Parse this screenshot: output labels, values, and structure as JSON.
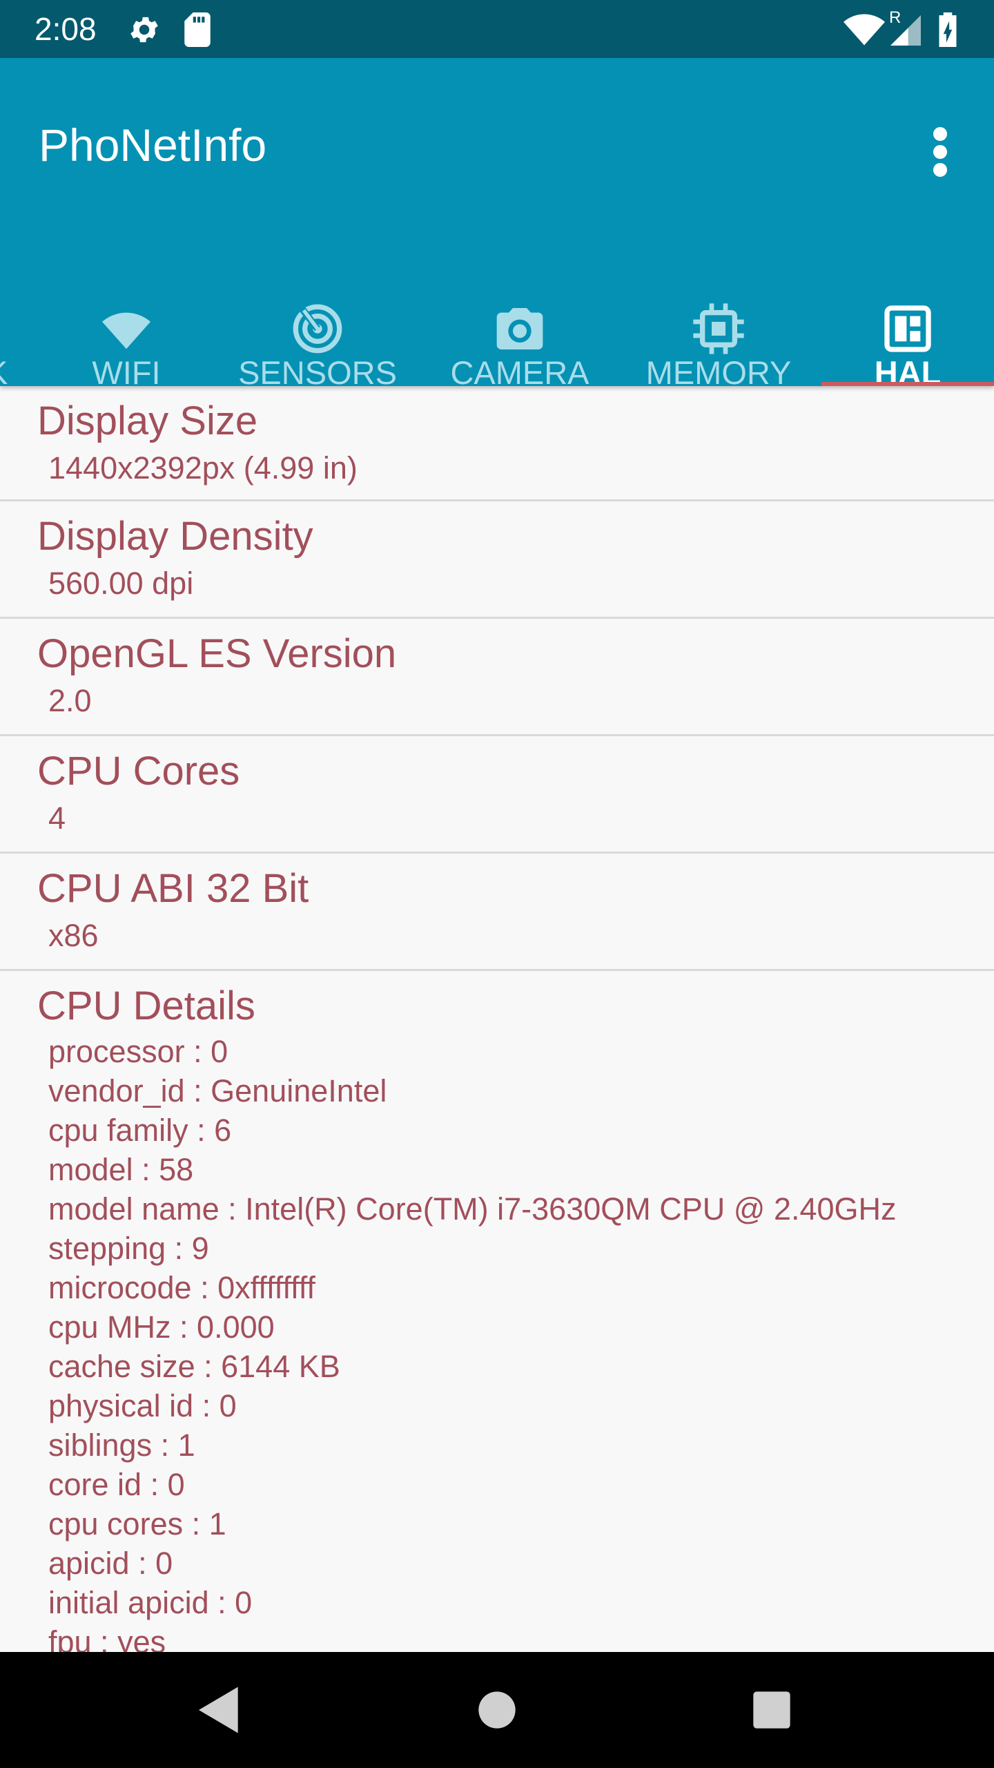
{
  "status_bar": {
    "time": "2:08",
    "icons": [
      "gear-icon",
      "sd-card-icon",
      "wifi-icon",
      "cell-signal-icon",
      "battery-charging-icon"
    ],
    "roaming_label": "R"
  },
  "app_bar": {
    "title": "PhoNetInfo"
  },
  "tabs": [
    {
      "label": "K",
      "icon": "partial-tab"
    },
    {
      "label": "WIFI",
      "icon": "wifi-icon"
    },
    {
      "label": "SENSORS",
      "icon": "sensor-icon"
    },
    {
      "label": "CAMERA",
      "icon": "camera-icon"
    },
    {
      "label": "MEMORY",
      "icon": "chip-icon"
    },
    {
      "label": "HAL",
      "icon": "dashboard-icon",
      "active": true
    }
  ],
  "items": [
    {
      "title": "Display Size",
      "value": "1440x2392px (4.99 in)"
    },
    {
      "title": "Display Density",
      "value": "560.00 dpi"
    },
    {
      "title": "OpenGL ES Version",
      "value": "2.0"
    },
    {
      "title": "CPU Cores",
      "value": "4"
    },
    {
      "title": "CPU ABI 32 Bit",
      "value": "x86"
    }
  ],
  "cpu_details": {
    "title": "CPU Details",
    "lines": [
      "processor  : 0",
      "vendor_id : GenuineIntel",
      "cpu family : 6",
      "model  : 58",
      "model name : Intel(R) Core(TM) i7-3630QM CPU @ 2.40GHz",
      "stepping : 9",
      "microcode : 0xffffffff",
      "cpu MHz  : 0.000",
      "cache size : 6144 KB",
      "physical id : 0",
      "siblings : 1",
      "core id   : 0",
      "cpu cores : 1",
      "apicid   : 0",
      "initial apicid  : 0",
      "fpu   : yes"
    ]
  },
  "colors": {
    "status_bar": "#05596D",
    "app_bar": "#0591B3",
    "accent_text": "#A24F5A",
    "tab_indicator": "#CF5A5E"
  }
}
